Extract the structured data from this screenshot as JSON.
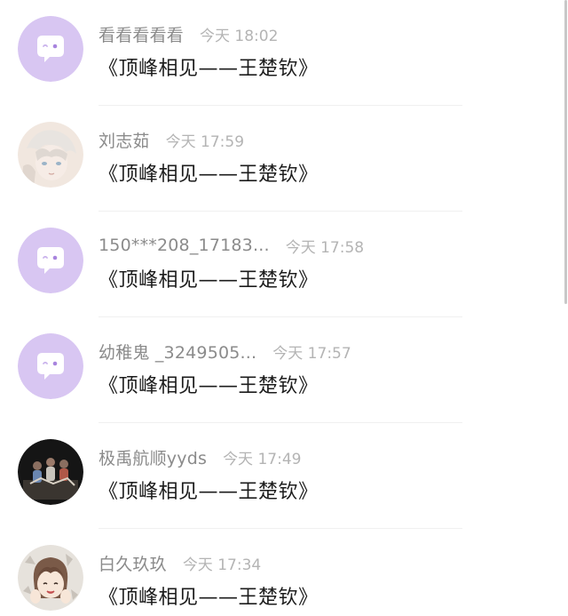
{
  "comments": [
    {
      "user": "看看看看看",
      "time": "今天 18:02",
      "text": "《顶峰相见——王楚钦》",
      "avatar": "default-bubble-avatar"
    },
    {
      "user": "刘志茹",
      "time": "今天 17:59",
      "text": "《顶峰相见——王楚钦》",
      "avatar": "anime-white-hair-avatar"
    },
    {
      "user": "150***208_17183...",
      "time": "今天 17:58",
      "text": "《顶峰相见——王楚钦》",
      "avatar": "default-bubble-avatar"
    },
    {
      "user": "幼稚鬼 _3249505...",
      "time": "今天 17:57",
      "text": "《顶峰相见——王楚钦》",
      "avatar": "default-bubble-avatar"
    },
    {
      "user": "极禹航顺yyds",
      "time": "今天 17:49",
      "text": "《顶峰相见——王楚钦》",
      "avatar": "group-photo-avatar"
    },
    {
      "user": "白久玖玖",
      "time": "今天 17:34",
      "text": "《顶峰相见——王楚钦》",
      "avatar": "anime-girl-avatar"
    }
  ],
  "colors": {
    "default_avatar_bg": "#d8c6f2",
    "name": "#8b8b8b",
    "time": "#b4b4b4",
    "text": "#1c1c1c"
  }
}
